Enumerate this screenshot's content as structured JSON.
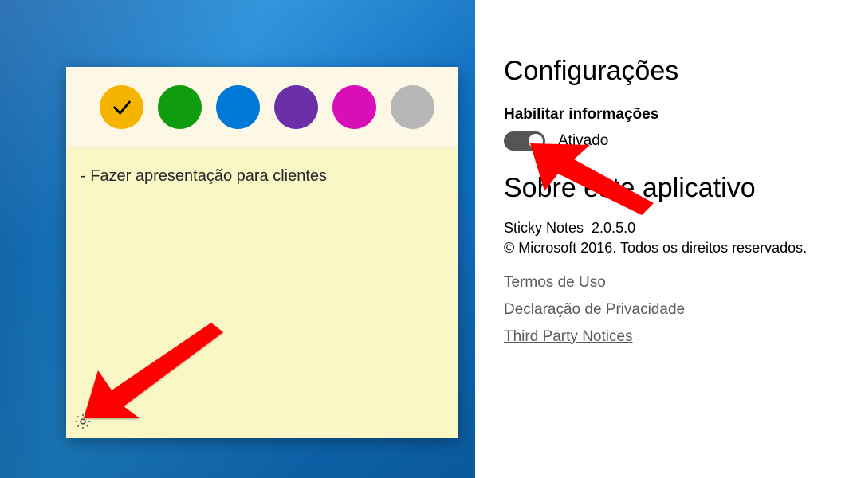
{
  "note": {
    "colors": [
      {
        "name": "yellow",
        "hex": "#f4b400",
        "selected": true
      },
      {
        "name": "green",
        "hex": "#0f9d0f",
        "selected": false
      },
      {
        "name": "blue",
        "hex": "#0078d7",
        "selected": false
      },
      {
        "name": "purple",
        "hex": "#6b2faa",
        "selected": false
      },
      {
        "name": "magenta",
        "hex": "#d80fb8",
        "selected": false
      },
      {
        "name": "gray",
        "hex": "#b7b7b7",
        "selected": false
      }
    ],
    "content": "- Fazer apresentação para clientes"
  },
  "settings": {
    "title": "Configurações",
    "enable_insights_label": "Habilitar informações",
    "toggle_state": "Ativado",
    "about_title": "Sobre este aplicativo",
    "app_name": "Sticky Notes",
    "app_version": "2.0.5.0",
    "copyright": "© Microsoft 2016. Todos os direitos reservados.",
    "links": {
      "terms": "Termos de Uso",
      "privacy": "Declaração de Privacidade",
      "third_party": "Third Party Notices"
    }
  }
}
